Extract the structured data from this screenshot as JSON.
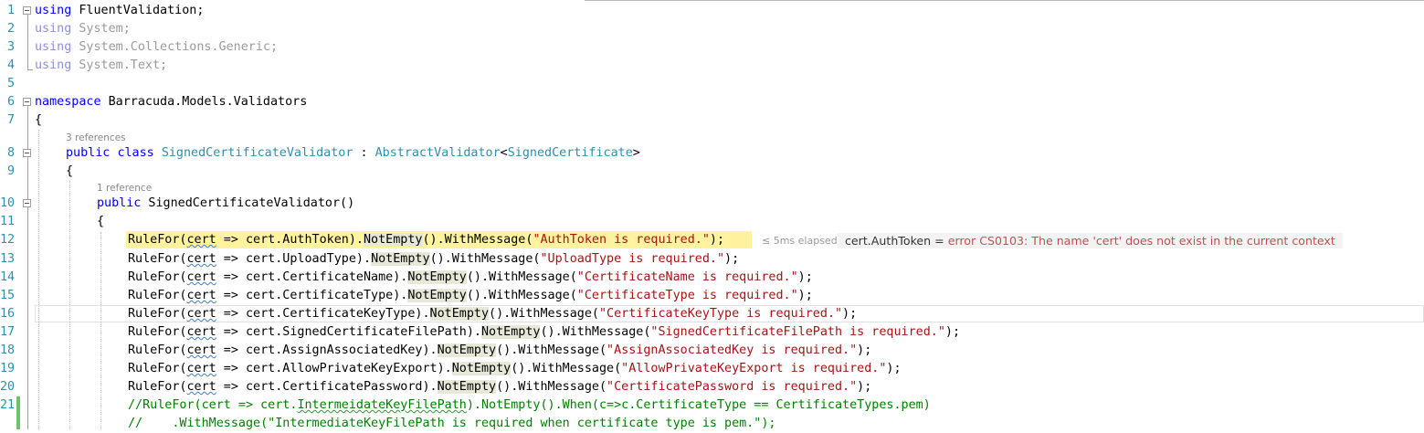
{
  "editor": {
    "lines": [
      {
        "n": "1",
        "parts": [
          {
            "t": "using",
            "c": "kw"
          },
          {
            "t": " FluentValidation;"
          }
        ]
      },
      {
        "n": "2",
        "parts": [
          {
            "t": "using",
            "c": "dimkw"
          },
          {
            "t": " System;",
            "c": "dim"
          }
        ]
      },
      {
        "n": "3",
        "parts": [
          {
            "t": "using",
            "c": "dimkw"
          },
          {
            "t": " System.Collections.Generic;",
            "c": "dim"
          }
        ]
      },
      {
        "n": "4",
        "parts": [
          {
            "t": "using",
            "c": "dimkw"
          },
          {
            "t": " System.Text;",
            "c": "dim"
          }
        ]
      },
      {
        "n": "5",
        "parts": []
      },
      {
        "n": "6",
        "parts": [
          {
            "t": "namespace",
            "c": "kw"
          },
          {
            "t": " Barracuda.Models.Validators"
          }
        ]
      },
      {
        "n": "7",
        "parts": [
          {
            "t": "{"
          }
        ]
      },
      {
        "n": "8",
        "parts": [
          {
            "t": "public",
            "c": "kw"
          },
          {
            "t": " "
          },
          {
            "t": "class",
            "c": "kw"
          },
          {
            "t": " "
          },
          {
            "t": "SignedCertificateValidator",
            "c": "ty"
          },
          {
            "t": " : "
          },
          {
            "t": "AbstractValidator",
            "c": "ty"
          },
          {
            "t": "<"
          },
          {
            "t": "SignedCertificate",
            "c": "ty"
          },
          {
            "t": ">"
          }
        ]
      },
      {
        "n": "9",
        "parts": [
          {
            "t": "{"
          }
        ]
      },
      {
        "n": "10",
        "parts": [
          {
            "t": "public",
            "c": "kw"
          },
          {
            "t": " SignedCertificateValidator()"
          }
        ]
      },
      {
        "n": "11",
        "parts": [
          {
            "t": "{"
          }
        ]
      },
      {
        "n": "12",
        "parts": [
          {
            "t": "RuleFor("
          },
          {
            "t": "cert",
            "c": "sq"
          },
          {
            "t": " => cert.AuthToken)."
          },
          {
            "t": "NotEmpty",
            "c": "hlbox"
          },
          {
            "t": "().WithMessage("
          },
          {
            "t": "\"AuthToken is required.\"",
            "c": "str"
          },
          {
            "t": ");"
          }
        ]
      },
      {
        "n": "13",
        "parts": [
          {
            "t": "RuleFor("
          },
          {
            "t": "cert",
            "c": "sq"
          },
          {
            "t": " => cert.UploadType)."
          },
          {
            "t": "NotEmpty",
            "c": "hlbox"
          },
          {
            "t": "().WithMessage("
          },
          {
            "t": "\"UploadType is required.\"",
            "c": "str"
          },
          {
            "t": ");"
          }
        ]
      },
      {
        "n": "14",
        "parts": [
          {
            "t": "RuleFor("
          },
          {
            "t": "cert",
            "c": "sq"
          },
          {
            "t": " => cert.CertificateName)."
          },
          {
            "t": "NotEmpty",
            "c": "hlbox"
          },
          {
            "t": "().WithMessage("
          },
          {
            "t": "\"CertificateName is required.\"",
            "c": "str"
          },
          {
            "t": ");"
          }
        ]
      },
      {
        "n": "15",
        "parts": [
          {
            "t": "RuleFor("
          },
          {
            "t": "cert",
            "c": "sq"
          },
          {
            "t": " => cert.CertificateType)."
          },
          {
            "t": "NotEmpty",
            "c": "hlbox"
          },
          {
            "t": "().WithMessage("
          },
          {
            "t": "\"CertificateType is required.\"",
            "c": "str"
          },
          {
            "t": ");"
          }
        ]
      },
      {
        "n": "16",
        "parts": [
          {
            "t": "RuleFor("
          },
          {
            "t": "cert",
            "c": "sq"
          },
          {
            "t": " => cert.CertificateKeyType)."
          },
          {
            "t": "NotEmpty",
            "c": "hlbox"
          },
          {
            "t": "().WithMessage("
          },
          {
            "t": "\"CertificateKeyType is required.\"",
            "c": "str"
          },
          {
            "t": ");"
          }
        ]
      },
      {
        "n": "17",
        "parts": [
          {
            "t": "RuleFor("
          },
          {
            "t": "cert",
            "c": "sq"
          },
          {
            "t": " => cert.SignedCertificateFilePath)."
          },
          {
            "t": "NotEmpty",
            "c": "hlbox"
          },
          {
            "t": "().WithMessage("
          },
          {
            "t": "\"SignedCertificateFilePath is required.\"",
            "c": "str"
          },
          {
            "t": ");"
          }
        ]
      },
      {
        "n": "18",
        "parts": [
          {
            "t": "RuleFor("
          },
          {
            "t": "cert",
            "c": "sq"
          },
          {
            "t": " => cert.AssignAssociatedKey)."
          },
          {
            "t": "NotEmpty",
            "c": "hlbox"
          },
          {
            "t": "().WithMessage("
          },
          {
            "t": "\"AssignAssociatedKey is required.\"",
            "c": "str"
          },
          {
            "t": ");"
          }
        ]
      },
      {
        "n": "19",
        "parts": [
          {
            "t": "RuleFor("
          },
          {
            "t": "cert",
            "c": "sq"
          },
          {
            "t": " => cert.AllowPrivateKeyExport)."
          },
          {
            "t": "NotEmpty",
            "c": "hlbox"
          },
          {
            "t": "().WithMessage("
          },
          {
            "t": "\"AllowPrivateKeyExport is required.\"",
            "c": "str"
          },
          {
            "t": ");"
          }
        ]
      },
      {
        "n": "20",
        "parts": [
          {
            "t": "RuleFor("
          },
          {
            "t": "cert",
            "c": "sq"
          },
          {
            "t": " => cert.CertificatePassword)."
          },
          {
            "t": "NotEmpty",
            "c": "hlbox"
          },
          {
            "t": "().WithMessage("
          },
          {
            "t": "\"CertificatePassword is required.\"",
            "c": "str"
          },
          {
            "t": ");"
          }
        ]
      },
      {
        "n": "21",
        "parts": [
          {
            "t": "//RuleFor(cert => cert.",
            "c": "cm"
          },
          {
            "t": "IntermeidateKeyFilePath",
            "c": "cm sqg"
          },
          {
            "t": ").NotEmpty().When(c=>c.CertificateType == CertificateTypes.pem)",
            "c": "cm"
          }
        ]
      },
      {
        "n": "",
        "parts": [
          {
            "t": "//    .WithMessage(\"IntermediateKeyFilePath is required when certificate type is pem.\");",
            "c": "cm"
          }
        ]
      }
    ],
    "codelens": {
      "class_refs": "3 references",
      "ctor_refs": "1 reference"
    },
    "perf_tip": "≤ 5ms elapsed",
    "datatip": {
      "expression": "cert.AuthToken = ",
      "error": "error CS0103: The name 'cert' does not exist in the current context"
    }
  }
}
